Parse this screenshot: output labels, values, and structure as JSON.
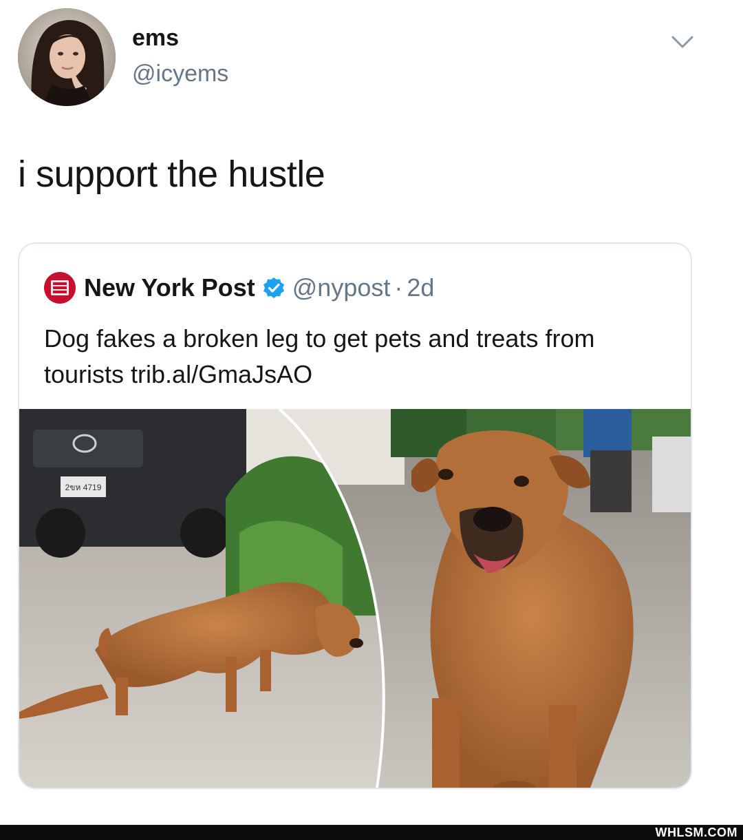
{
  "tweet": {
    "author": {
      "display_name": "ems",
      "handle": "@icyems"
    },
    "text": "i support the hustle",
    "quoted": {
      "source_name": "New York Post",
      "handle": "@nypost",
      "separator": "·",
      "time": "2d",
      "text": "Dog fakes a broken leg to get pets and treats from tourists trib.al/GmaJsAO",
      "logo_text": "NEW YORK POST",
      "plate_text": "2ขห 4719"
    }
  },
  "watermark": "WHLSM.COM",
  "colors": {
    "text": "#14171a",
    "secondary": "#657786",
    "verified": "#1da1f2",
    "nypost_red": "#c8102e",
    "border": "#e1e8ed"
  },
  "icons": {
    "caret": "chevron-down-icon",
    "verified": "verified-badge-icon"
  }
}
